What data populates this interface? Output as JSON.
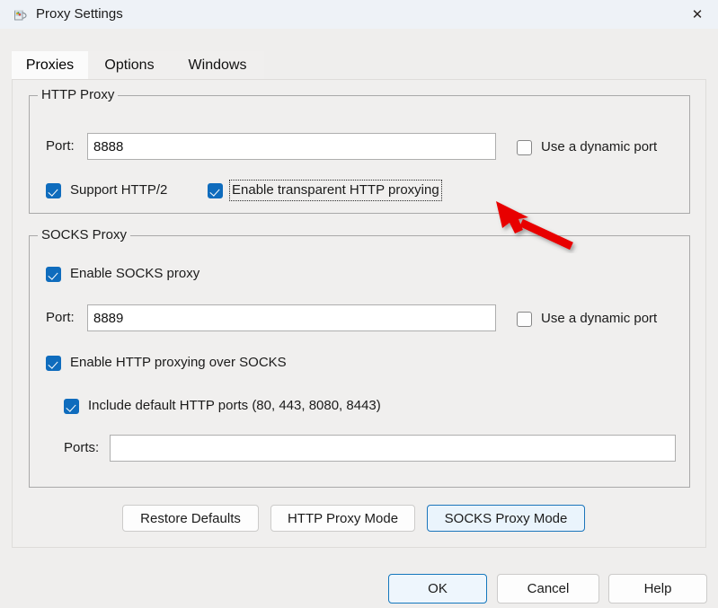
{
  "window": {
    "title": "Proxy Settings",
    "icon": "proxy-jug-icon",
    "close_label": "✕"
  },
  "tabs": [
    {
      "label": "Proxies",
      "selected": true
    },
    {
      "label": "Options",
      "selected": false
    },
    {
      "label": "Windows",
      "selected": false
    }
  ],
  "http_proxy": {
    "group_title": "HTTP Proxy",
    "port_label": "Port:",
    "port_value": "8888",
    "port_placeholder": "",
    "dynamic_port_label": "Use a dynamic port",
    "dynamic_port_checked": false,
    "support_http2_label": "Support HTTP/2",
    "support_http2_checked": true,
    "transparent_label": "Enable transparent HTTP proxying",
    "transparent_checked": true,
    "transparent_focused": true
  },
  "socks_proxy": {
    "group_title": "SOCKS Proxy",
    "enable_label": "Enable SOCKS proxy",
    "enable_checked": true,
    "port_label": "Port:",
    "port_value": "8889",
    "port_placeholder": "",
    "dynamic_port_label": "Use a dynamic port",
    "dynamic_port_checked": false,
    "http_over_socks_label": "Enable HTTP proxying over SOCKS",
    "http_over_socks_checked": true,
    "include_default_ports_label": "Include default HTTP ports (80, 443, 8080, 8443)",
    "include_default_ports_checked": true,
    "ports_label": "Ports:",
    "ports_value": "",
    "ports_placeholder": ""
  },
  "mode_buttons": {
    "restore_defaults": "Restore Defaults",
    "http_proxy_mode": "HTTP Proxy Mode",
    "socks_proxy_mode": "SOCKS Proxy Mode"
  },
  "dialog_buttons": {
    "ok": "OK",
    "cancel": "Cancel",
    "help": "Help"
  },
  "annotation": {
    "type": "red-arrow",
    "color": "#e80000",
    "points_at": "Enable transparent HTTP proxying"
  },
  "colors": {
    "accent": "#0f6cbd",
    "titlebar_bg": "#eef2f7",
    "panel_bg": "#f0efee",
    "window_bg": "#efeeed",
    "arrow": "#e80000"
  }
}
